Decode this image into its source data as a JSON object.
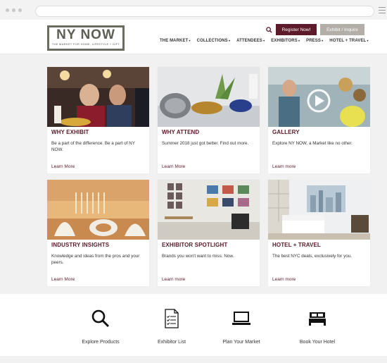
{
  "header": {
    "logo_main": "NY NOW",
    "logo_tagline": "THE MARKET FOR HOME, LIFESTYLE + GIFT",
    "register_label": "Register Now!",
    "exhibit_label": "Exhibit / Inquire",
    "nav": [
      "THE MARKET",
      "COLLECTIONS",
      "ATTENDEES",
      "EXHIBITORS",
      "PRESS",
      "HOTEL + TRAVEL"
    ]
  },
  "cards": [
    {
      "title": "WHY EXHIBIT",
      "desc": "Be a part of the difference. Be a part of NY NOW.",
      "link": "Learn More"
    },
    {
      "title": "WHY ATTEND",
      "desc": "Summer 2018 just got better. Find out more.",
      "link": "Learn More"
    },
    {
      "title": "GALLERY",
      "desc": "Explore NY NOW, a Market like no other.",
      "link": "Learn more"
    },
    {
      "title": "INDUSTRY INSIGHTS",
      "desc": "Knowledge and ideas from the pros and your peers.",
      "link": "Learn More"
    },
    {
      "title": "EXHIBITOR SPOTLIGHT",
      "desc": "Brands you won't want to miss. Now.",
      "link": "Learn more"
    },
    {
      "title": "HOTEL + TRAVEL",
      "desc": "The best NYC deals, exclusively for you.",
      "link": "Learn more"
    }
  ],
  "features": [
    {
      "label": "Explore Products",
      "icon": "search-icon"
    },
    {
      "label": "Exhibitor List",
      "icon": "checklist-icon"
    },
    {
      "label": "Plan Your Market",
      "icon": "laptop-icon"
    },
    {
      "label": "Book Your Hotel",
      "icon": "bed-icon"
    }
  ],
  "colors": {
    "accent": "#5c1a2a",
    "secondary": "#b3aea7"
  }
}
